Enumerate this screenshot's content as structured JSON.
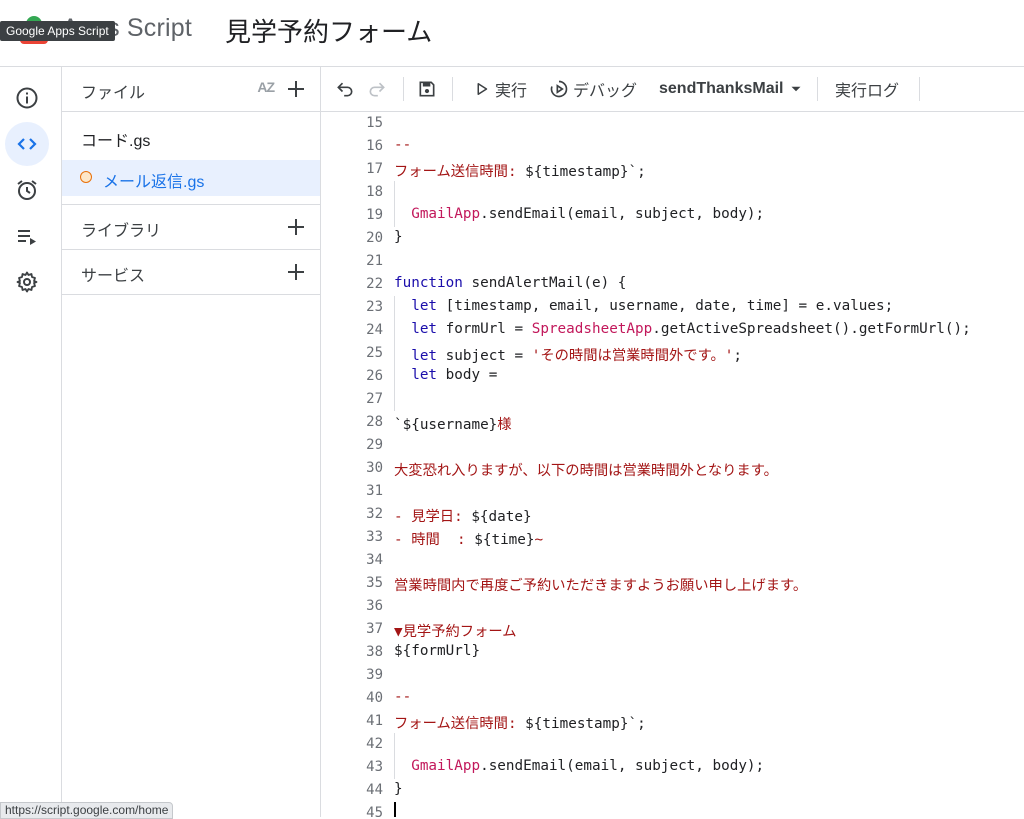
{
  "header": {
    "brand": "Apps Script",
    "project_title": "見学予約フォーム",
    "tooltip": "Google Apps Script"
  },
  "rail": {
    "items": [
      {
        "name": "overview-icon",
        "active": false
      },
      {
        "name": "editor-icon",
        "active": true
      },
      {
        "name": "triggers-icon",
        "active": false
      },
      {
        "name": "executions-icon",
        "active": false
      },
      {
        "name": "settings-icon",
        "active": false
      }
    ]
  },
  "files_panel": {
    "files_label": "ファイル",
    "sort_label": "AZ",
    "files": [
      {
        "name": "コード.gs",
        "selected": false
      },
      {
        "name": "メール返信.gs",
        "selected": true,
        "unsaved": true
      }
    ],
    "libraries_label": "ライブラリ",
    "services_label": "サービス"
  },
  "toolbar": {
    "run_label": "実行",
    "debug_label": "デバッグ",
    "function_select": "sendThanksMail",
    "log_label": "実行ログ"
  },
  "editor": {
    "lines": [
      {
        "n": "15",
        "tokens": [
          {
            "t": "",
            "c": "str"
          }
        ]
      },
      {
        "n": "16",
        "tokens": [
          {
            "t": "--",
            "c": "str"
          }
        ]
      },
      {
        "n": "17",
        "tokens": [
          {
            "t": "フォーム送信時間: ",
            "c": "str"
          },
          {
            "t": "${timestamp}",
            "c": "plain"
          },
          {
            "t": "`;",
            "c": "plain"
          }
        ]
      },
      {
        "n": "18",
        "tokens": [],
        "guide": true
      },
      {
        "n": "19",
        "tokens": [
          {
            "t": "  ",
            "c": "plain"
          },
          {
            "t": "GmailApp",
            "c": "cls"
          },
          {
            "t": ".sendEmail(email, subject, body);",
            "c": "plain"
          }
        ],
        "guide": true
      },
      {
        "n": "20",
        "tokens": [
          {
            "t": "}",
            "c": "plain"
          }
        ]
      },
      {
        "n": "21",
        "tokens": []
      },
      {
        "n": "22",
        "tokens": [
          {
            "t": "function",
            "c": "kw"
          },
          {
            "t": " sendAlertMail(e) {",
            "c": "plain"
          }
        ]
      },
      {
        "n": "23",
        "tokens": [
          {
            "t": "  ",
            "c": "plain"
          },
          {
            "t": "let",
            "c": "kw"
          },
          {
            "t": " [timestamp, email, username, date, time] = e.values;",
            "c": "plain"
          }
        ],
        "guide": true
      },
      {
        "n": "24",
        "tokens": [
          {
            "t": "  ",
            "c": "plain"
          },
          {
            "t": "let",
            "c": "kw"
          },
          {
            "t": " formUrl = ",
            "c": "plain"
          },
          {
            "t": "SpreadsheetApp",
            "c": "cls"
          },
          {
            "t": ".getActiveSpreadsheet().getFormUrl();",
            "c": "plain"
          }
        ],
        "guide": true
      },
      {
        "n": "25",
        "tokens": [
          {
            "t": "  ",
            "c": "plain"
          },
          {
            "t": "let",
            "c": "kw"
          },
          {
            "t": " subject = ",
            "c": "plain"
          },
          {
            "t": "'その時間は営業時間外です。'",
            "c": "str"
          },
          {
            "t": ";",
            "c": "plain"
          }
        ],
        "guide": true
      },
      {
        "n": "26",
        "tokens": [
          {
            "t": "  ",
            "c": "plain"
          },
          {
            "t": "let",
            "c": "kw"
          },
          {
            "t": " body = ",
            "c": "plain"
          }
        ],
        "guide": true
      },
      {
        "n": "27",
        "tokens": [],
        "guide": true
      },
      {
        "n": "28",
        "tokens": [
          {
            "t": "`",
            "c": "plain"
          },
          {
            "t": "${username}",
            "c": "plain"
          },
          {
            "t": "様",
            "c": "str"
          }
        ]
      },
      {
        "n": "29",
        "tokens": []
      },
      {
        "n": "30",
        "tokens": [
          {
            "t": "大変恐れ入りますが、以下の時間は営業時間外となります。",
            "c": "str"
          }
        ]
      },
      {
        "n": "31",
        "tokens": []
      },
      {
        "n": "32",
        "tokens": [
          {
            "t": "- 見学日: ",
            "c": "str"
          },
          {
            "t": "${date}",
            "c": "plain"
          }
        ]
      },
      {
        "n": "33",
        "tokens": [
          {
            "t": "- 時間  : ",
            "c": "str"
          },
          {
            "t": "${time}",
            "c": "plain"
          },
          {
            "t": "~",
            "c": "str"
          }
        ]
      },
      {
        "n": "34",
        "tokens": []
      },
      {
        "n": "35",
        "tokens": [
          {
            "t": "営業時間内で再度ご予約いただきますようお願い申し上げます。",
            "c": "str"
          }
        ]
      },
      {
        "n": "36",
        "tokens": []
      },
      {
        "n": "37",
        "tokens": [
          {
            "t": "▼見学予約フォーム",
            "c": "str"
          }
        ]
      },
      {
        "n": "38",
        "tokens": [
          {
            "t": "${formUrl}",
            "c": "plain"
          }
        ]
      },
      {
        "n": "39",
        "tokens": []
      },
      {
        "n": "40",
        "tokens": [
          {
            "t": "--",
            "c": "str"
          }
        ]
      },
      {
        "n": "41",
        "tokens": [
          {
            "t": "フォーム送信時間: ",
            "c": "str"
          },
          {
            "t": "${timestamp}",
            "c": "plain"
          },
          {
            "t": "`;",
            "c": "plain"
          }
        ]
      },
      {
        "n": "42",
        "tokens": [],
        "guide": true
      },
      {
        "n": "43",
        "tokens": [
          {
            "t": "  ",
            "c": "plain"
          },
          {
            "t": "GmailApp",
            "c": "cls"
          },
          {
            "t": ".sendEmail(email, subject, body);",
            "c": "plain"
          }
        ],
        "guide": true
      },
      {
        "n": "44",
        "tokens": [
          {
            "t": "}",
            "c": "plain"
          }
        ]
      },
      {
        "n": "45",
        "tokens": []
      }
    ]
  },
  "status_url": "https://script.google.com/home"
}
